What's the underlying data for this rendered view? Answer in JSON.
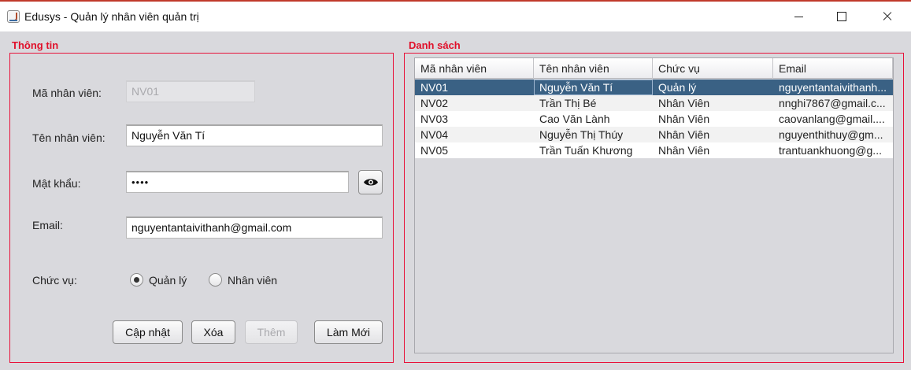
{
  "window": {
    "title": "Edusys - Quản lý nhân viên quản trị"
  },
  "info_panel": {
    "title": "Thông tin",
    "employee_id": {
      "label": "Mã nhân viên:",
      "value": "NV01"
    },
    "employee_name": {
      "label": "Tên nhân viên:",
      "value": "Nguyễn Văn Tí"
    },
    "password": {
      "label": "Mật khẩu:",
      "value": "••••"
    },
    "email": {
      "label": "Email:",
      "value": "nguyentantaivithanh@gmail.com"
    },
    "role": {
      "label": "Chức vụ:",
      "options": [
        {
          "label": "Quản lý",
          "checked": true
        },
        {
          "label": "Nhân viên",
          "checked": false
        }
      ]
    },
    "buttons": {
      "update": "Cập nhật",
      "delete": "Xóa",
      "add": "Thêm",
      "reset": "Làm Mới"
    }
  },
  "list_panel": {
    "title": "Danh sách",
    "columns": [
      "Mã nhân viên",
      "Tên nhân viên",
      "Chức vụ",
      "Email"
    ],
    "rows": [
      [
        "NV01",
        "Nguyễn Văn Tí",
        "Quản lý",
        "nguyentantaivithanh..."
      ],
      [
        "NV02",
        "Trần Thị Bé",
        "Nhân Viên",
        "nnghi7867@gmail.c..."
      ],
      [
        "NV03",
        "Cao Văn Lành",
        "Nhân Viên",
        "caovanlang@gmail...."
      ],
      [
        "NV04",
        "Nguyễn Thị Thúy",
        "Nhân Viên",
        "nguyenthithuy@gm..."
      ],
      [
        "NV05",
        "Trần Tuấn Khương",
        "Nhân Viên",
        "trantuankhuong@g..."
      ]
    ],
    "selected_row": 0
  },
  "icons": {
    "app": "java-cup-icon",
    "password_toggle": "eye-icon"
  },
  "colors": {
    "group_border": "#e8123a",
    "group_title": "#e0102a",
    "selected_row": "#3a6184"
  }
}
